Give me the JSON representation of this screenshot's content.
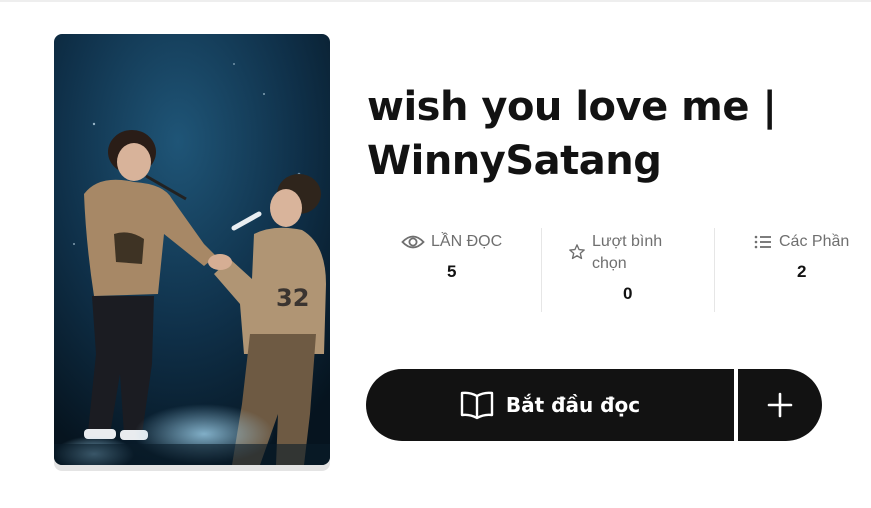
{
  "story": {
    "title": "wish you love me | WinnySatang",
    "cover_image": "concert-photo-two-performers-holding-hands"
  },
  "stats": [
    {
      "label": "LẦN ĐỌC",
      "value": "5",
      "icon": "eye-icon"
    },
    {
      "label": "Lượt bình chọn",
      "value": "0",
      "icon": "star-icon"
    },
    {
      "label": "Các Phần",
      "value": "2",
      "icon": "list-icon"
    }
  ],
  "actions": {
    "start_reading": "Bắt đầu đọc",
    "start_reading_icon": "open-book-icon",
    "add_icon": "plus-icon"
  },
  "colors": {
    "button_bg": "#121212",
    "stat_label": "#6f6f6f",
    "divider": "#e6e6e6"
  }
}
